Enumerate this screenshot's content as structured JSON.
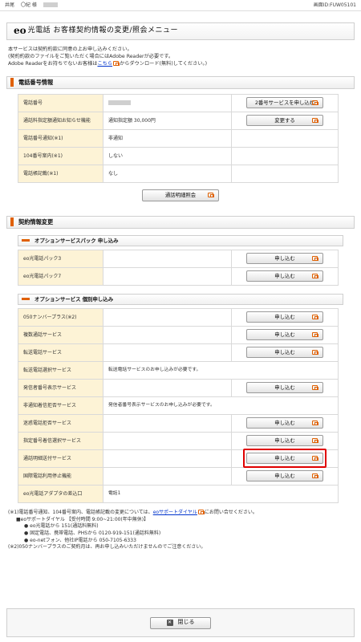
{
  "header": {
    "left_label": "井尾",
    "left_user": "〇紀 様",
    "screen_id": "画面ID:FUW05101"
  },
  "title": {
    "brand": "eo",
    "text": "光電話 お客様契約情報の変更/照会メニュー"
  },
  "intro": {
    "line1": "本サービスは契約約款に同意の上お申し込みください。",
    "line2": "(契約約款のファイルをご覧いただく場合にはAdobe Readerが必要です。",
    "line3_pre": "Adobe Readerをお持ちでないお客様は",
    "line3_link": "こちら",
    "line3_post": "からダウンロード(無料)してください。)"
  },
  "phone_section": {
    "title": "電話番号情報",
    "rows": [
      {
        "label": "電話番号",
        "value": "",
        "button": "2番号サービスを申し込む"
      },
      {
        "label": "通話料指定額通知お知らせ機能",
        "value": "通知指定額 30,000円",
        "button": "変更する"
      },
      {
        "label": "電話番号通知(※1)",
        "value": "非通知",
        "button": ""
      },
      {
        "label": "104番号案内(※1)",
        "value": "しない",
        "button": ""
      },
      {
        "label": "電話帳記載(※1)",
        "value": "なし",
        "button": ""
      }
    ],
    "detail_button": "通話明細照会"
  },
  "contract_section": {
    "title": "契約情報変更",
    "pack_title": "オプションサービスパック 申し込み",
    "pack_rows": [
      {
        "label": "eo光電話パック3",
        "value": "",
        "button": "申し込む"
      },
      {
        "label": "eo光電話パック7",
        "value": "",
        "button": "申し込む"
      }
    ],
    "option_title": "オプションサービス 個別申し込み",
    "option_rows": [
      {
        "label": "050ナンバープラス(※2)",
        "value": "",
        "button": "申し込む"
      },
      {
        "label": "複数通話サービス",
        "value": "",
        "button": "申し込む"
      },
      {
        "label": "転送電話サービス",
        "value": "",
        "button": "申し込む"
      },
      {
        "label": "転送電話選択サービス",
        "value": "転送電話サービスのお申し込みが必要です。",
        "button": ""
      },
      {
        "label": "発信者番号表示サービス",
        "value": "",
        "button": "申し込む"
      },
      {
        "label": "非通知着信拒否サービス",
        "value": "発信者番号表示サービスのお申し込みが必要です。",
        "button": ""
      },
      {
        "label": "迷惑電話拒否サービス",
        "value": "",
        "button": "申し込む"
      },
      {
        "label": "指定番号着信選択サービス",
        "value": "",
        "button": "申し込む"
      },
      {
        "label": "通話明細送付サービス",
        "value": "",
        "button": "申し込む"
      },
      {
        "label": "国際電話利用停止機能",
        "value": "",
        "button": "申し込む"
      },
      {
        "label": "eo光電話アダプタの差込口",
        "value": "電話1",
        "button": ""
      }
    ]
  },
  "notes": {
    "n1_pre": "(※1)電話番号通知、104番号案内、電話帳記載の変更については、",
    "n1_link": "eoサポートダイヤル",
    "n1_post": "にお問い合せください。",
    "n2": "■eoサポートダイヤル 【受付時間 9:00~21:00(年中無休)】",
    "n3": "● eo光電話から 151(通話料無料)",
    "n4": "● 固定電話、携帯電話、PHSから 0120-919-151(通話料無料)",
    "n5": "● eo-netフォン、他社IP電話から 050-7105-6333",
    "n6": "(※2)050ナンバープラスのご契約月は、再お申し込みいただけませんのでご注意ください。"
  },
  "footer": {
    "close_label": "閉じる"
  },
  "colors": {
    "accent": "#e06000",
    "label_bg": "#fdf3d6",
    "highlight": "#e00000"
  }
}
